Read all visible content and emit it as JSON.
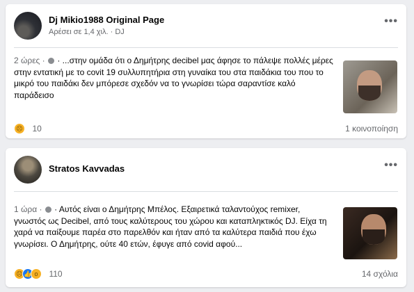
{
  "posts": [
    {
      "author": "Dj Mikio1988 Original Page",
      "subline": "Αρέσει σε 1,4 χιλ. · DJ",
      "time": "2 ώρες · ",
      "text": " · ...στην ομάδα ότι ο Δημήτρης decibel μας άφησε το πάλεψε πολλές μέρες στην εντατική με το covit 19 συλλυπητήρια στη γυναίκα του στα παιδάκια του που το μικρό του παιδάκι δεν μπόρεσε σχεδόν να το γνωρίσει τώρα σαραντίσε καλό παράδεισο",
      "reaction_count": "10",
      "shares": "1 κοινοποίηση",
      "reactions": [
        "sad"
      ]
    },
    {
      "author": "Stratos Kavvadas",
      "time": "1 ώρα · ",
      "text": " · Αυτός είναι ο Δημήτρης Μπέλος. Εξαιρετικά ταλαντούχος remixer, γνωστός ως Decibel, από τους καλύτερους του χώρου και καταπληκτικός DJ. Είχα τη χαρά να παίξουμε παρέα στο παρελθόν και ήταν από τα καλύτερα παιδιά που έχω γνωρίσει. Ο Δημήτρης, ούτε 40 ετών, έφυγε από covid αφού...",
      "reaction_count": "110",
      "comments": "14 σχόλια",
      "reactions": [
        "sad",
        "like",
        "wow"
      ]
    }
  ],
  "icons": {
    "more": "more-options-icon",
    "privacy": "globe-icon",
    "sad": "sad-reaction-icon",
    "like": "like-reaction-icon",
    "wow": "wow-reaction-icon"
  }
}
